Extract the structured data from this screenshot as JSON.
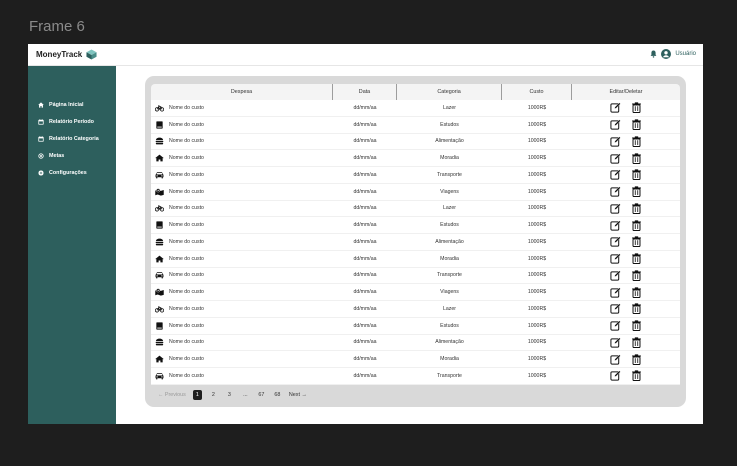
{
  "frame_label": "Frame 6",
  "brand": {
    "name": "MoneyTrack",
    "icon": "cube-icon"
  },
  "user": {
    "label": "Usuário",
    "bell_icon": "bell-icon",
    "user_icon": "user-circle-icon"
  },
  "sidebar": {
    "items": [
      {
        "label": "Página Inicial",
        "icon": "home-icon"
      },
      {
        "label": "Relatório Período",
        "icon": "calendar-icon"
      },
      {
        "label": "Relatório Categoria",
        "icon": "calendar-icon"
      },
      {
        "label": "Metas",
        "icon": "target-icon"
      },
      {
        "label": "Configurações",
        "icon": "gear-icon"
      }
    ]
  },
  "table": {
    "headers": [
      "Despesa",
      "Data",
      "Categoria",
      "Custo",
      "Editar/Deletar"
    ],
    "rows": [
      {
        "name": "Nome do custo",
        "date": "dd/mm/aa",
        "category": "Lazer",
        "cost": "1000R$",
        "icon": "bicycle-icon"
      },
      {
        "name": "Nome do custo",
        "date": "dd/mm/aa",
        "category": "Estudos",
        "cost": "1000R$",
        "icon": "book-icon"
      },
      {
        "name": "Nome do custo",
        "date": "dd/mm/aa",
        "category": "Alimentação",
        "cost": "1000R$",
        "icon": "burger-icon"
      },
      {
        "name": "Nome do custo",
        "date": "dd/mm/aa",
        "category": "Moradia",
        "cost": "1000R$",
        "icon": "house-icon"
      },
      {
        "name": "Nome do custo",
        "date": "dd/mm/aa",
        "category": "Transporte",
        "cost": "1000R$",
        "icon": "car-icon"
      },
      {
        "name": "Nome do custo",
        "date": "dd/mm/aa",
        "category": "Viagens",
        "cost": "1000R$",
        "icon": "map-icon"
      },
      {
        "name": "Nome do custo",
        "date": "dd/mm/aa",
        "category": "Lazer",
        "cost": "1000R$",
        "icon": "bicycle-icon"
      },
      {
        "name": "Nome do custo",
        "date": "dd/mm/aa",
        "category": "Estudos",
        "cost": "1000R$",
        "icon": "book-icon"
      },
      {
        "name": "Nome do custo",
        "date": "dd/mm/aa",
        "category": "Alimentação",
        "cost": "1000R$",
        "icon": "burger-icon"
      },
      {
        "name": "Nome do custo",
        "date": "dd/mm/aa",
        "category": "Moradia",
        "cost": "1000R$",
        "icon": "house-icon"
      },
      {
        "name": "Nome do custo",
        "date": "dd/mm/aa",
        "category": "Transporte",
        "cost": "1000R$",
        "icon": "car-icon"
      },
      {
        "name": "Nome do custo",
        "date": "dd/mm/aa",
        "category": "Viagens",
        "cost": "1000R$",
        "icon": "map-icon"
      },
      {
        "name": "Nome do custo",
        "date": "dd/mm/aa",
        "category": "Lazer",
        "cost": "1000R$",
        "icon": "bicycle-icon"
      },
      {
        "name": "Nome do custo",
        "date": "dd/mm/aa",
        "category": "Estudos",
        "cost": "1000R$",
        "icon": "book-icon"
      },
      {
        "name": "Nome do custo",
        "date": "dd/mm/aa",
        "category": "Alimentação",
        "cost": "1000R$",
        "icon": "burger-icon"
      },
      {
        "name": "Nome do custo",
        "date": "dd/mm/aa",
        "category": "Moradia",
        "cost": "1000R$",
        "icon": "house-icon"
      },
      {
        "name": "Nome do custo",
        "date": "dd/mm/aa",
        "category": "Transporte",
        "cost": "1000R$",
        "icon": "car-icon"
      }
    ]
  },
  "pagination": {
    "previous": "← Previous",
    "pages": [
      "1",
      "2",
      "3",
      "...",
      "67",
      "68"
    ],
    "active": "1",
    "next": "Next →"
  },
  "colors": {
    "sidebar": "#2d5f5d",
    "panel": "#d9d9d9",
    "background": "#1e1e1e",
    "accent": "#2d5f5d"
  }
}
